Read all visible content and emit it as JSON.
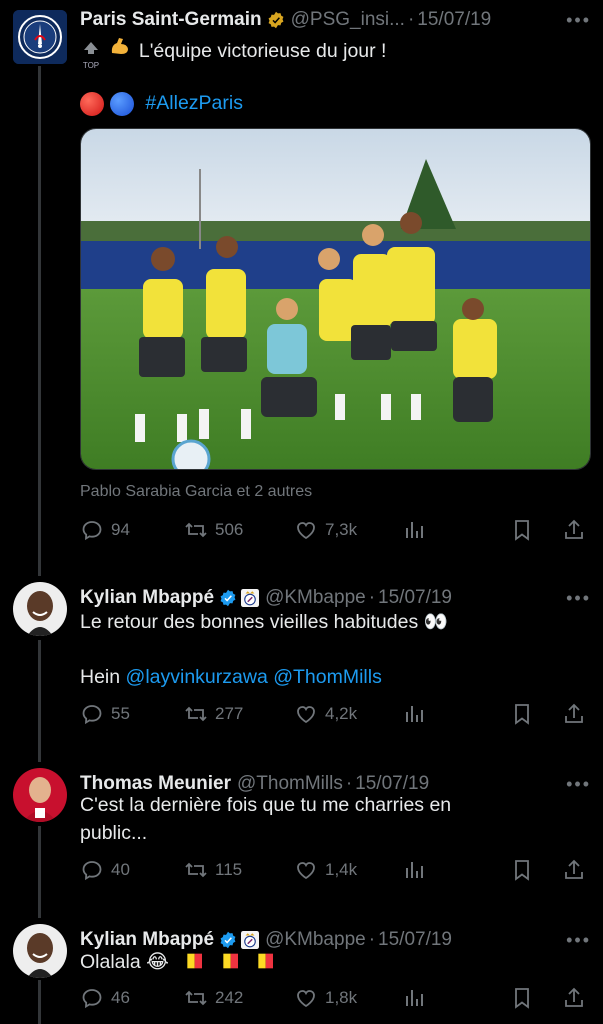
{
  "tweets": [
    {
      "name": "Paris Saint-Germain",
      "handle": "@PSG_insi...",
      "date": "15/07/19",
      "top_label": "TOP",
      "text_line1": "L'équipe victorieuse du jour !",
      "hashtag": "#AllezParis",
      "caption": "Pablo Sarabia Garcia et 2 autres",
      "replies": "94",
      "retweets": "506",
      "likes": "7,3k"
    },
    {
      "name": "Kylian Mbappé",
      "handle": "@KMbappe",
      "date": "15/07/19",
      "text_line1": "Le retour des bonnes vieilles habitudes 👀",
      "text_line2_prefix": "Hein",
      "mention1": "@layvinkurzawa",
      "mention2": "@ThomMills",
      "replies": "55",
      "retweets": "277",
      "likes": "4,2k"
    },
    {
      "name": "Thomas Meunier",
      "handle": "@ThomMills",
      "date": "15/07/19",
      "text_line1": "C'est la dernière fois que tu me charries en",
      "text_line2": "public...",
      "replies": "40",
      "retweets": "115",
      "likes": "1,4k"
    },
    {
      "name": "Kylian Mbappé",
      "handle": "@KMbappe",
      "date": "15/07/19",
      "text_line1": "Olalala 😂",
      "replies": "46",
      "retweets": "242",
      "likes": "1,8k"
    }
  ],
  "sep": "·",
  "more": "•••",
  "psg_logo_text": "PARIS",
  "colors": {
    "accent": "#1d9bf0",
    "muted": "#71767b",
    "verified_gold": "#d8a520",
    "verified_blue": "#1d9bf0"
  },
  "icons": [
    "reply-icon",
    "retweet-icon",
    "like-icon",
    "views-icon",
    "bookmark-icon",
    "share-icon",
    "verified-icon",
    "real-madrid-badge-icon"
  ]
}
